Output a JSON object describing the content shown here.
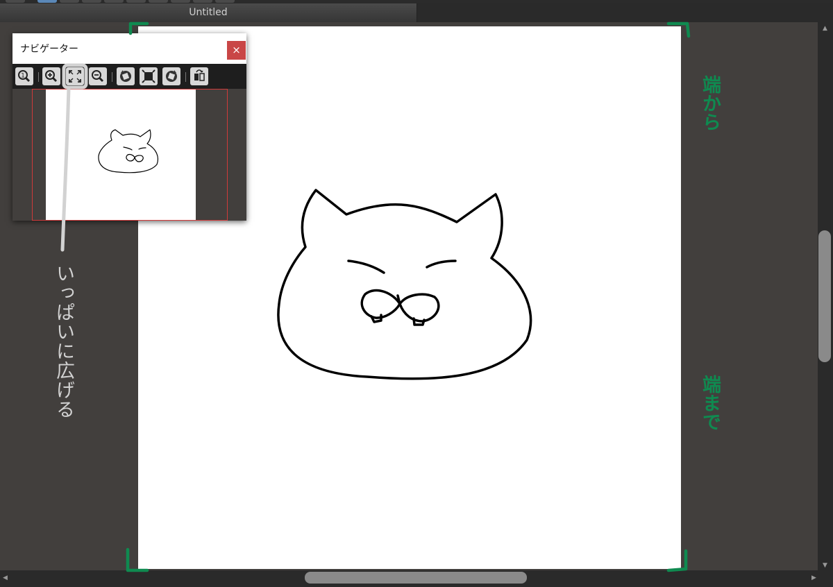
{
  "window": {
    "tab_title": "Untitled"
  },
  "navigator": {
    "title": "ナビゲーター",
    "close_label": "×",
    "tools": [
      {
        "icon": "zoom-actual-size-icon"
      },
      {
        "icon": "zoom-in-icon"
      },
      {
        "icon": "fit-to-window-icon"
      },
      {
        "icon": "zoom-out-icon"
      },
      {
        "icon": "rotate-left-icon"
      },
      {
        "icon": "fit-canvas-icon"
      },
      {
        "icon": "rotate-right-icon"
      },
      {
        "icon": "flip-horizontal-icon"
      }
    ]
  },
  "annotations": {
    "gray_label": "いっぱいに広げる",
    "green_top": "端から",
    "green_bottom": "端まで",
    "gray_color": "#d2d2d2",
    "green_color": "#0f8a50"
  },
  "colors": {
    "workspace": "#423f3d",
    "close_button": "#c94646",
    "preview_frame": "#d03a3a",
    "active_tool": "#5b88b8"
  }
}
